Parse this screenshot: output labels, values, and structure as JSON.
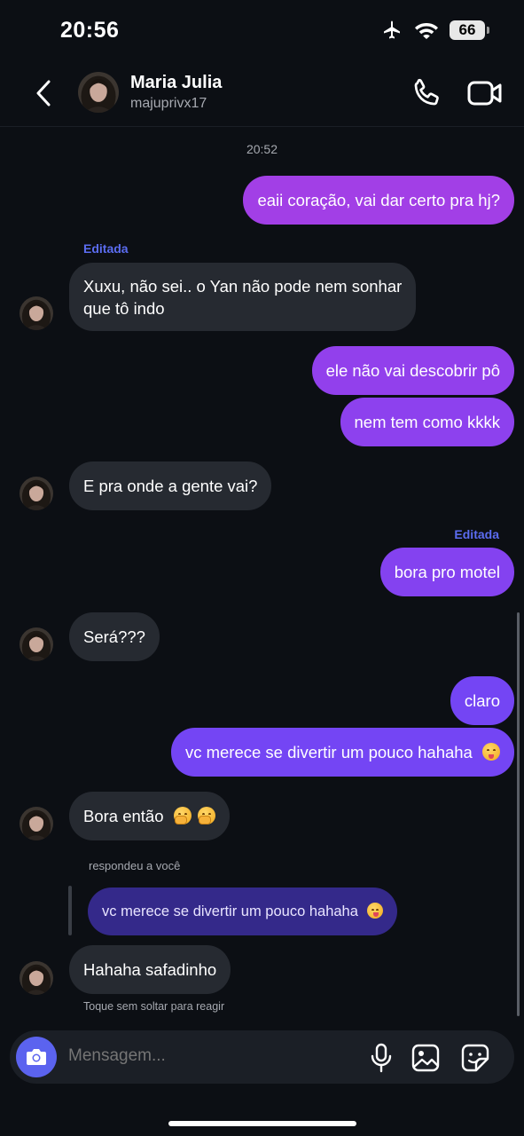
{
  "status": {
    "time": "20:56",
    "battery": "66"
  },
  "header": {
    "name": "Maria Julia",
    "username": "majuprivx17"
  },
  "thread": {
    "timestamp": "20:52",
    "msg1": "eaii coração, vai dar certo pra hj?",
    "edited1": "Editada",
    "msg2_line1": "Xuxu, não sei.. o Yan não pode nem sonhar",
    "msg2_line2": "que tô indo",
    "msg3": "ele não vai descobrir pô",
    "msg4": "nem tem como kkkk",
    "msg5": "E pra onde a gente vai?",
    "edited2": "Editada",
    "msg6": "bora pro motel",
    "msg7": "Será???",
    "msg8": "claro",
    "msg9": "vc merece se divertir um pouco hahaha",
    "msg10": "Bora então",
    "reply_label": "respondeu a você",
    "reply_quote": "vc merece se divertir um pouco hahaha",
    "msg11": "Hahaha safadinho",
    "react_hint": "Toque sem soltar para reagir"
  },
  "composer": {
    "placeholder": "Mensagem..."
  },
  "icons": {
    "back": "chevron-left-icon",
    "call": "phone-icon",
    "video": "video-camera-icon",
    "camera": "camera-icon",
    "mic": "microphone-icon",
    "gallery": "image-icon",
    "sticker": "sticker-icon"
  },
  "colors": {
    "background": "#0c0f14",
    "outgoing_bubble": "#8b3ef0",
    "incoming_bubble": "#262a31",
    "accent": "#5b63ef",
    "edited_label": "#5b6cf0"
  }
}
